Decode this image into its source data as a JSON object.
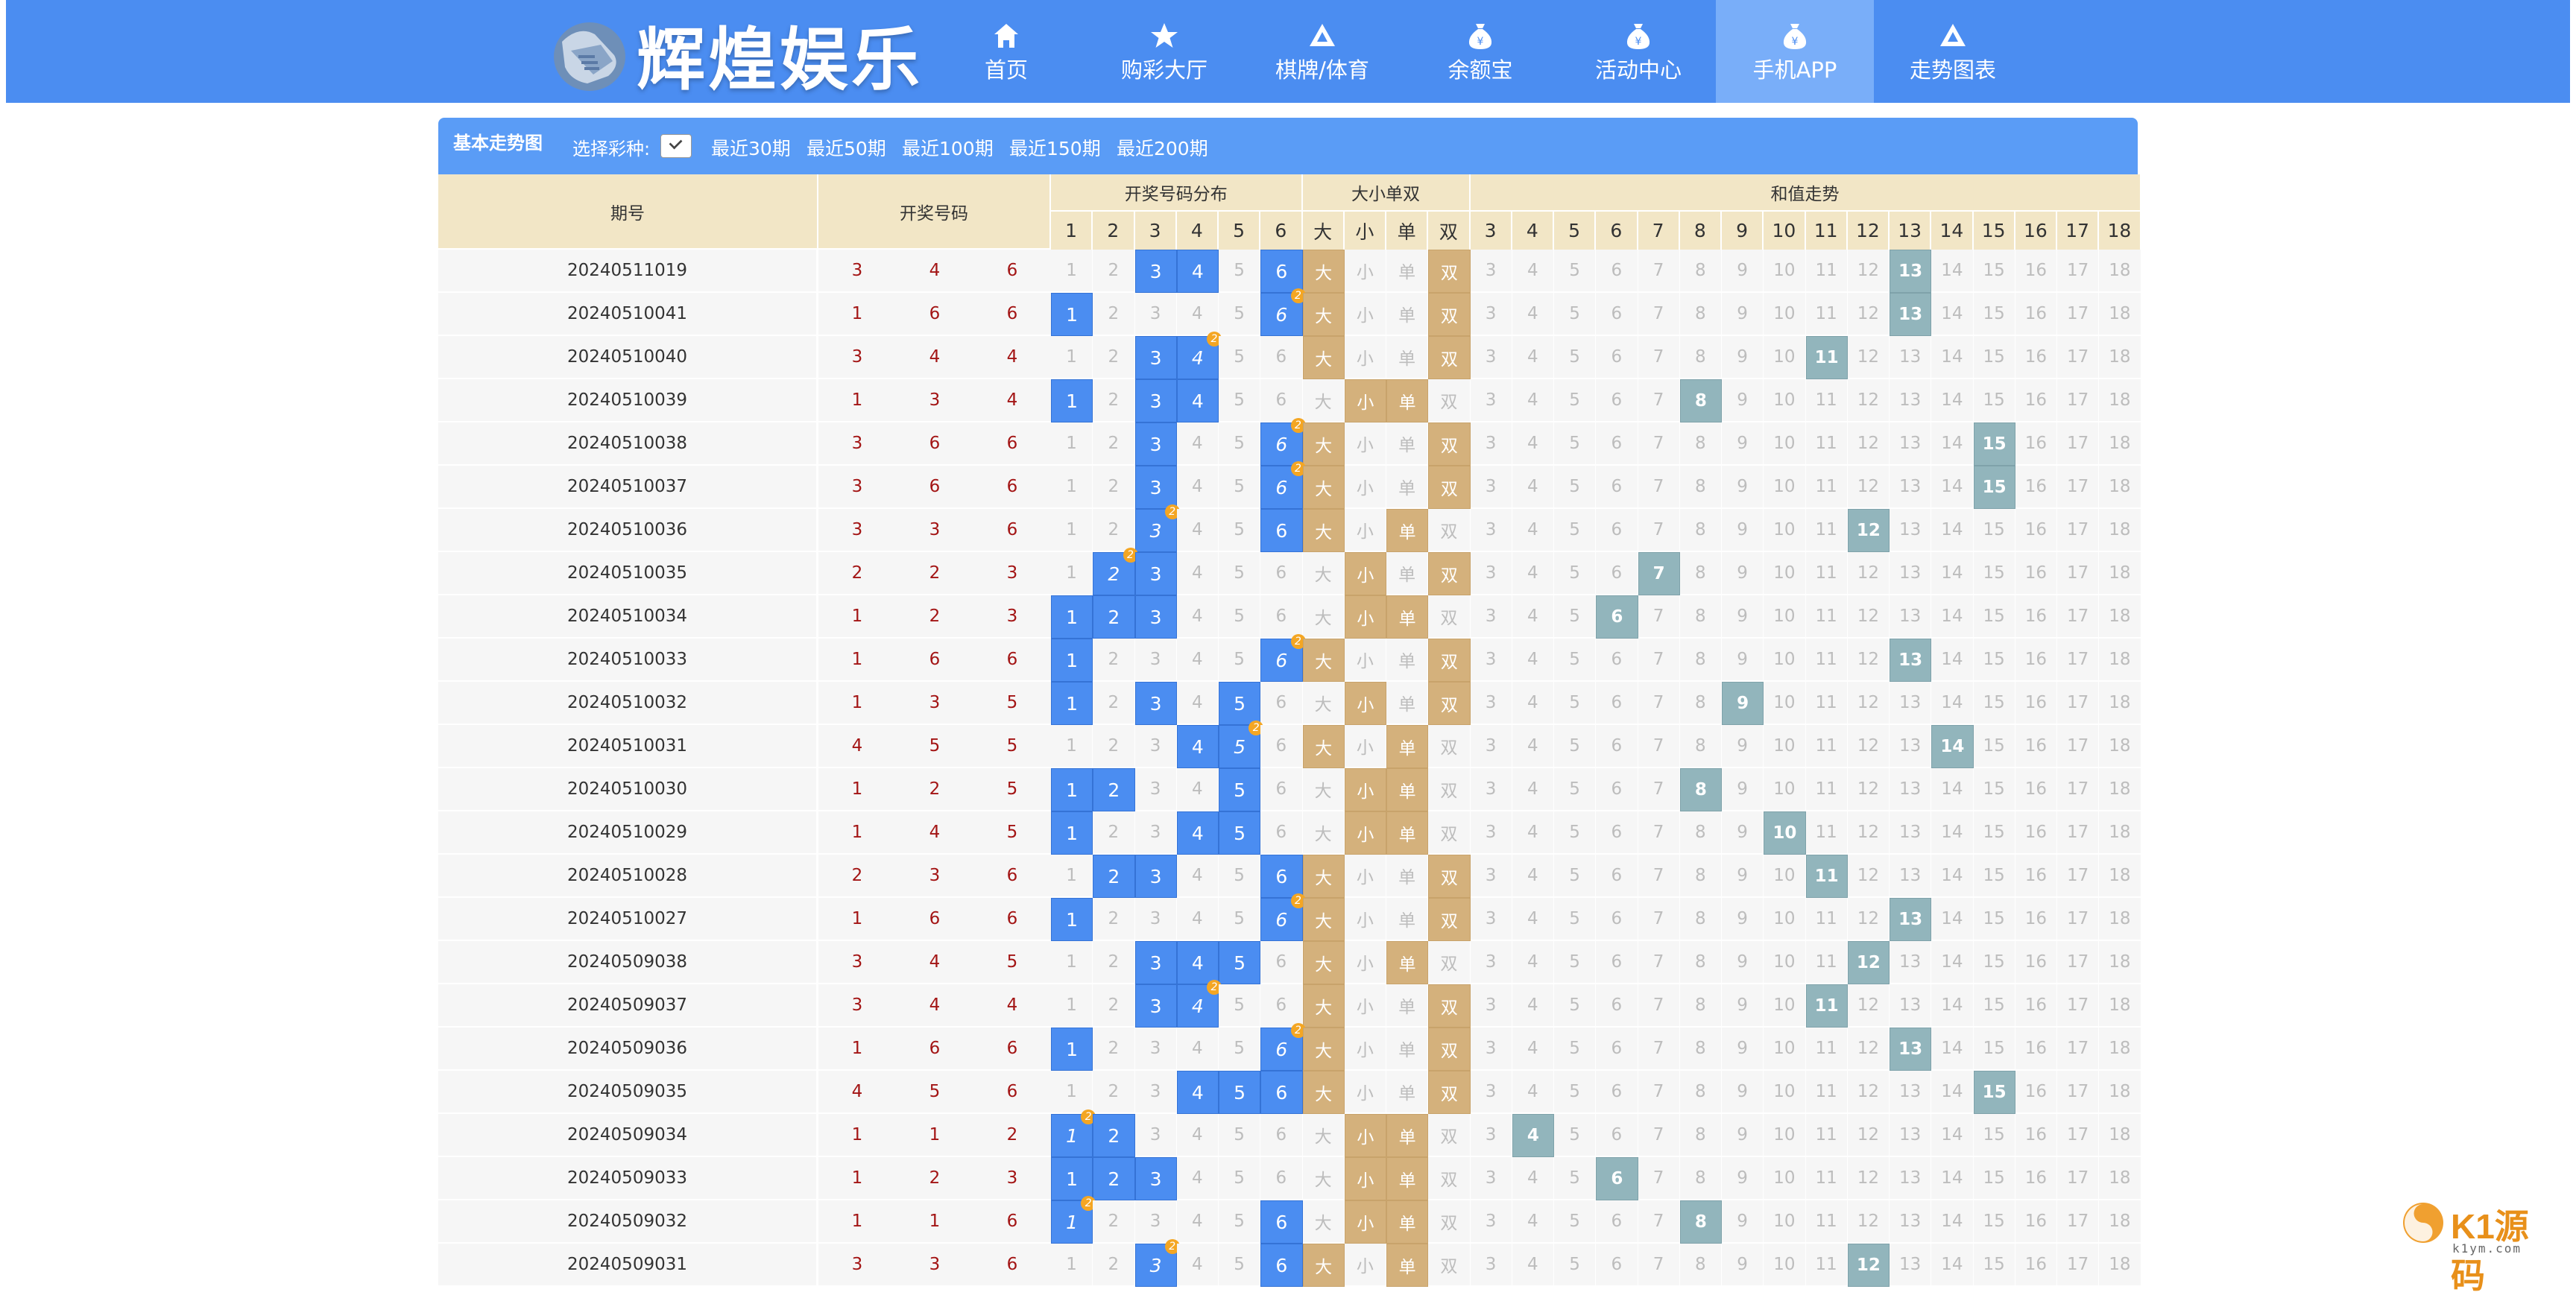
{
  "brand": {
    "title": "辉煌娱乐"
  },
  "nav": [
    {
      "label": "首页",
      "icon": "home-icon"
    },
    {
      "label": "购彩大厅",
      "icon": "star-icon"
    },
    {
      "label": "棋牌/体育",
      "icon": "triangle-icon"
    },
    {
      "label": "余额宝",
      "icon": "money-bag-icon"
    },
    {
      "label": "活动中心",
      "icon": "money-bag-icon"
    },
    {
      "label": "手机APP",
      "icon": "money-bag-icon",
      "active": true
    },
    {
      "label": "走势图表",
      "icon": "triangle-icon"
    }
  ],
  "panel": {
    "title": "基本走势图",
    "lottery_label": "选择彩种:",
    "period_links": [
      "最近30期",
      "最近50期",
      "最近100期",
      "最近150期",
      "最近200期"
    ]
  },
  "table": {
    "headers": {
      "period": "期号",
      "draw": "开奖号码",
      "distribution": "开奖号码分布",
      "size_parity": "大小单双",
      "sum_trend": "和值走势"
    },
    "dist_cols": [
      "1",
      "2",
      "3",
      "4",
      "5",
      "6"
    ],
    "sp_cols": [
      "大",
      "小",
      "单",
      "双"
    ],
    "sum_cols": [
      "3",
      "4",
      "5",
      "6",
      "7",
      "8",
      "9",
      "10",
      "11",
      "12",
      "13",
      "14",
      "15",
      "16",
      "17",
      "18"
    ],
    "rows": [
      {
        "period": "20240511019",
        "draw": [
          3,
          4,
          6
        ]
      },
      {
        "period": "20240510041",
        "draw": [
          1,
          6,
          6
        ]
      },
      {
        "period": "20240510040",
        "draw": [
          3,
          4,
          4
        ]
      },
      {
        "period": "20240510039",
        "draw": [
          1,
          3,
          4
        ]
      },
      {
        "period": "20240510038",
        "draw": [
          3,
          6,
          6
        ]
      },
      {
        "period": "20240510037",
        "draw": [
          3,
          6,
          6
        ]
      },
      {
        "period": "20240510036",
        "draw": [
          3,
          3,
          6
        ]
      },
      {
        "period": "20240510035",
        "draw": [
          2,
          2,
          3
        ]
      },
      {
        "period": "20240510034",
        "draw": [
          1,
          2,
          3
        ]
      },
      {
        "period": "20240510033",
        "draw": [
          1,
          6,
          6
        ]
      },
      {
        "period": "20240510032",
        "draw": [
          1,
          3,
          5
        ]
      },
      {
        "period": "20240510031",
        "draw": [
          4,
          5,
          5
        ]
      },
      {
        "period": "20240510030",
        "draw": [
          1,
          2,
          5
        ]
      },
      {
        "period": "20240510029",
        "draw": [
          1,
          4,
          5
        ]
      },
      {
        "period": "20240510028",
        "draw": [
          2,
          3,
          6
        ]
      },
      {
        "period": "20240510027",
        "draw": [
          1,
          6,
          6
        ]
      },
      {
        "period": "20240509038",
        "draw": [
          3,
          4,
          5
        ]
      },
      {
        "period": "20240509037",
        "draw": [
          3,
          4,
          4
        ]
      },
      {
        "period": "20240509036",
        "draw": [
          1,
          6,
          6
        ]
      },
      {
        "period": "20240509035",
        "draw": [
          4,
          5,
          6
        ]
      },
      {
        "period": "20240509034",
        "draw": [
          1,
          1,
          2
        ]
      },
      {
        "period": "20240509033",
        "draw": [
          1,
          2,
          3
        ]
      },
      {
        "period": "20240509032",
        "draw": [
          1,
          1,
          6
        ]
      },
      {
        "period": "20240509031",
        "draw": [
          3,
          3,
          6
        ]
      }
    ]
  },
  "colors": {
    "nav_bg": "#4b8df1",
    "nav_active": "#79aef9",
    "number_ball": "#4b8df1",
    "size_parity": "#d4b17c",
    "sum_marker": "#92b5bc",
    "repeat_badge": "#f4a623",
    "draw_text": "#a31515",
    "header_bg": "#f2e6c6"
  },
  "watermark": {
    "text": "K1源码",
    "url": "k1ym.com"
  }
}
